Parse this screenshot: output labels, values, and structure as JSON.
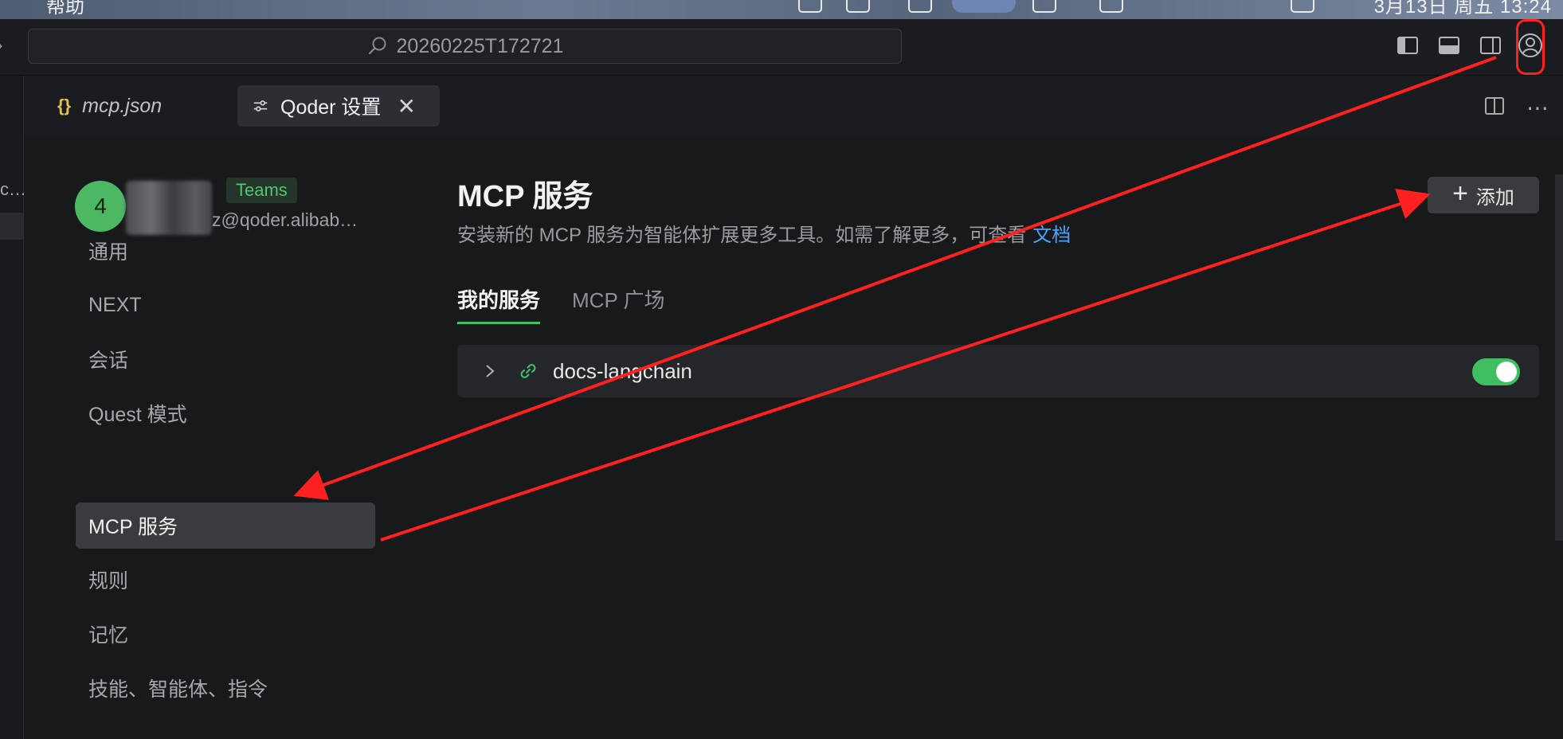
{
  "menubar": {
    "left_text": "帮助",
    "right_text": "3月13日 周五 13:24"
  },
  "titlebar": {
    "search_text": "20260225T172721"
  },
  "activity": {
    "fragment": "c…"
  },
  "tabs": [
    {
      "label": "mcp.json",
      "icon": "json-braces-icon",
      "active": false
    },
    {
      "label": "Qoder 设置",
      "icon": "settings-sliders-icon",
      "active": true
    }
  ],
  "profile": {
    "avatar_initial": "4",
    "badge": "Teams",
    "email": "z@qoder.alibab…"
  },
  "nav": {
    "items": [
      {
        "label": "通用",
        "active": false
      },
      {
        "label": "NEXT",
        "active": false
      },
      {
        "label": "会话",
        "active": false
      },
      {
        "label": "Quest 模式",
        "active": false
      },
      {
        "label": "MCP 服务",
        "active": true
      },
      {
        "label": "规则",
        "active": false
      },
      {
        "label": "记忆",
        "active": false
      },
      {
        "label": "技能、智能体、指令",
        "active": false
      }
    ]
  },
  "main": {
    "title": "MCP 服务",
    "description": "安装新的 MCP 服务为智能体扩展更多工具。如需了解更多，可查看",
    "doc_link": "文档",
    "add_button": "添加",
    "subtabs": [
      {
        "label": "我的服务",
        "active": true
      },
      {
        "label": "MCP 广场",
        "active": false
      }
    ],
    "servers": [
      {
        "name": "docs-langchain",
        "enabled": true
      }
    ]
  },
  "colors": {
    "accent_green": "#3fbf62",
    "link_blue": "#4aa3ff",
    "annotation_red": "#ff2020"
  }
}
